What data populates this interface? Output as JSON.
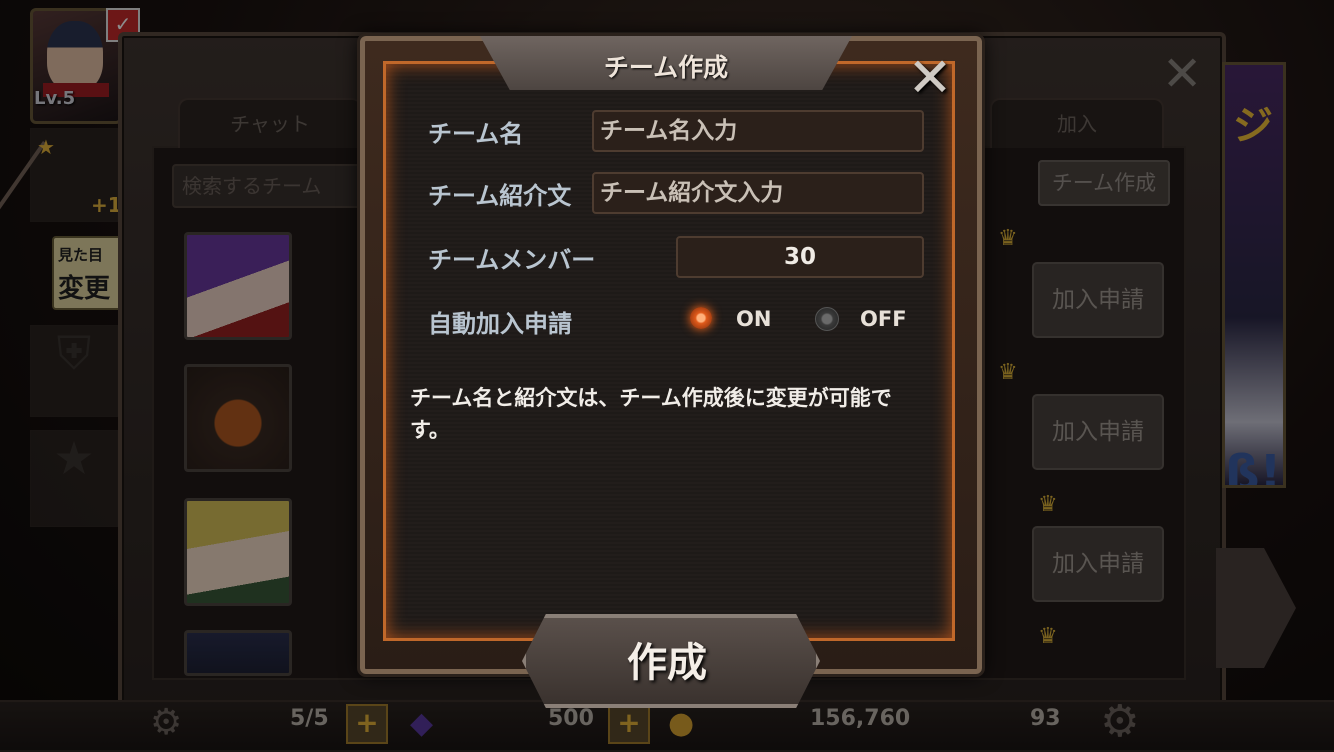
{
  "player": {
    "level": "Lv.5"
  },
  "sidebar": {
    "plus": "+1",
    "costume_line1": "見た目",
    "costume_line2": "変更"
  },
  "back_panel": {
    "tabs": [
      {
        "label": "チャット"
      },
      {
        "label": "加入"
      }
    ],
    "search_placeholder": "検索するチーム",
    "create_team_button": "チーム作成",
    "join_buttons": [
      "加入申請",
      "加入申請",
      "加入申請"
    ],
    "banner_text_top": "ジ",
    "banner_text_bottom": "ß!"
  },
  "modal": {
    "title": "チーム作成",
    "fields": {
      "team_name_label": "チーム名",
      "team_name_placeholder": "チーム名入力",
      "team_intro_label": "チーム紹介文",
      "team_intro_placeholder": "チーム紹介文入力",
      "team_member_label": "チームメンバー",
      "team_member_value": "30",
      "auto_join_label": "自動加入申請",
      "auto_join_on": "ON",
      "auto_join_off": "OFF",
      "auto_join_selected": "ON"
    },
    "notice": "チーム名と紹介文は、チーム作成後に変更が可能です。",
    "create_button": "作成"
  },
  "hud": {
    "stamina": "5/5",
    "gems": "500",
    "gold": "156,760",
    "tickets": "93"
  },
  "colors": {
    "accent_orange": "#c0682a",
    "crown_gold": "#e0b53a",
    "radio_on": "#e05a1a"
  },
  "icons": [
    "close-icon",
    "crown-icon",
    "gear-icon",
    "gem-icon",
    "coin-icon",
    "plus-icon",
    "star-icon",
    "shield-icon",
    "check-icon"
  ]
}
